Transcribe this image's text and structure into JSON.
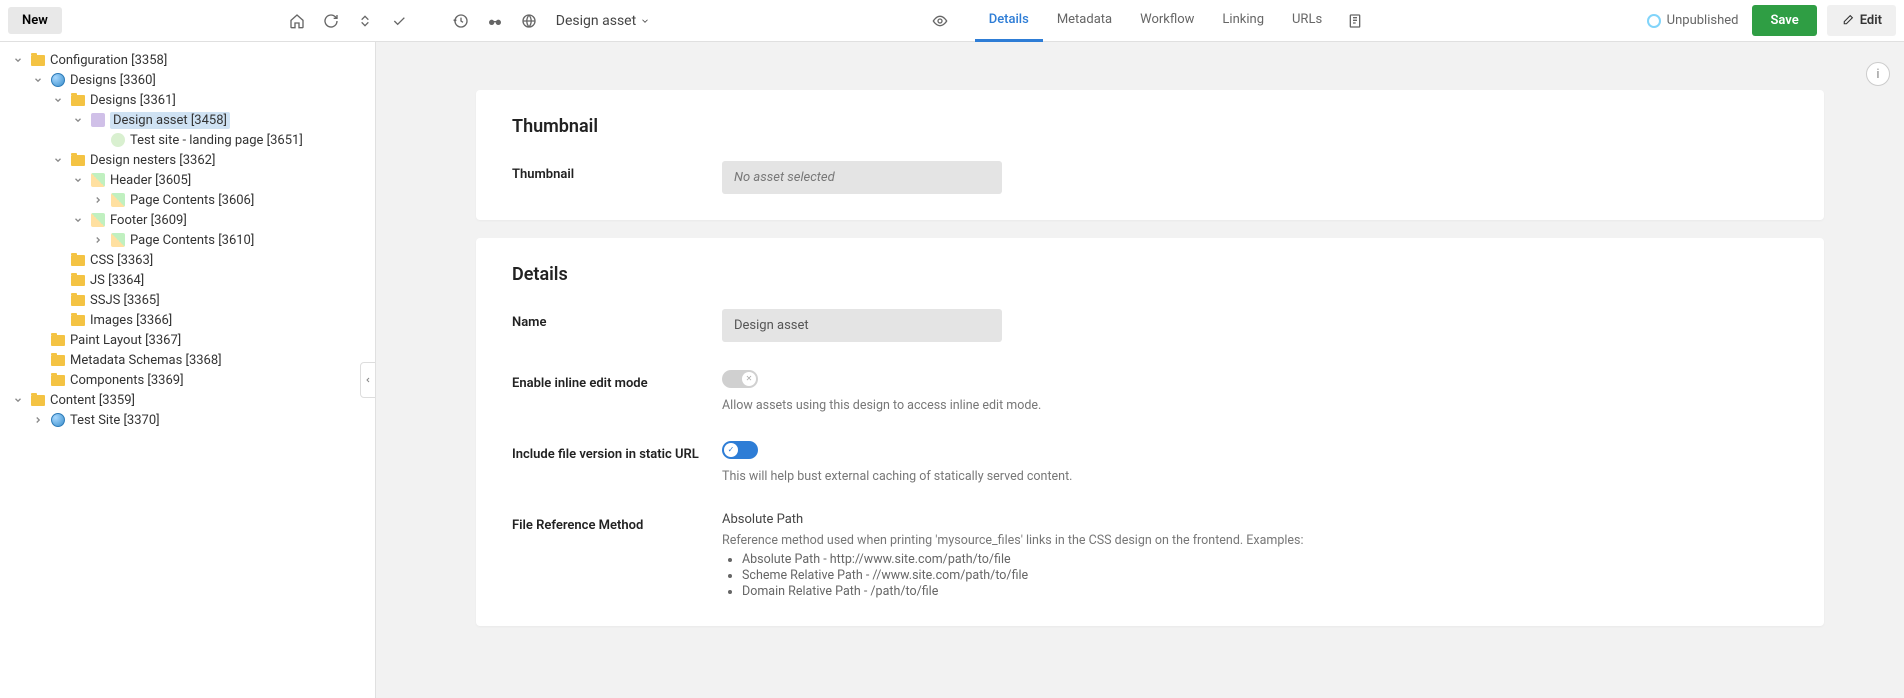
{
  "toolbar": {
    "new_label": "New",
    "breadcrumb": "Design asset",
    "tabs": [
      "Details",
      "Metadata",
      "Workflow",
      "Linking",
      "URLs"
    ],
    "active_tab": 0,
    "status": "Unpublished",
    "save_label": "Save",
    "edit_label": "Edit"
  },
  "tree": [
    {
      "depth": 0,
      "exp": "down",
      "icon": "folder",
      "label": "Configuration [3358]"
    },
    {
      "depth": 1,
      "exp": "down",
      "icon": "site",
      "label": "Designs [3360]"
    },
    {
      "depth": 2,
      "exp": "down",
      "icon": "folder",
      "label": "Designs [3361]"
    },
    {
      "depth": 3,
      "exp": "down",
      "icon": "design",
      "label": "Design asset [3458]",
      "selected": true
    },
    {
      "depth": 4,
      "exp": "none",
      "icon": "apply",
      "label": "Test site - landing page [3651]"
    },
    {
      "depth": 2,
      "exp": "down",
      "icon": "folder",
      "label": "Design nesters [3362]"
    },
    {
      "depth": 3,
      "exp": "down",
      "icon": "nester",
      "label": "Header [3605]"
    },
    {
      "depth": 4,
      "exp": "right",
      "icon": "nester",
      "label": "Page Contents [3606]"
    },
    {
      "depth": 3,
      "exp": "down",
      "icon": "nester",
      "label": "Footer [3609]"
    },
    {
      "depth": 4,
      "exp": "right",
      "icon": "nester",
      "label": "Page Contents [3610]"
    },
    {
      "depth": 2,
      "exp": "none",
      "icon": "folder",
      "label": "CSS [3363]"
    },
    {
      "depth": 2,
      "exp": "none",
      "icon": "folder",
      "label": "JS [3364]"
    },
    {
      "depth": 2,
      "exp": "none",
      "icon": "folder",
      "label": "SSJS [3365]"
    },
    {
      "depth": 2,
      "exp": "none",
      "icon": "folder",
      "label": "Images [3366]"
    },
    {
      "depth": 1,
      "exp": "none",
      "icon": "folder",
      "label": "Paint Layout [3367]"
    },
    {
      "depth": 1,
      "exp": "none",
      "icon": "folder",
      "label": "Metadata Schemas [3368]"
    },
    {
      "depth": 1,
      "exp": "none",
      "icon": "folder",
      "label": "Components [3369]"
    },
    {
      "depth": 0,
      "exp": "down",
      "icon": "folder",
      "label": "Content [3359]"
    },
    {
      "depth": 1,
      "exp": "right",
      "icon": "site",
      "label": "Test Site [3370]"
    }
  ],
  "panels": {
    "thumbnail": {
      "heading": "Thumbnail",
      "field_label": "Thumbnail",
      "value": "No asset selected"
    },
    "details": {
      "heading": "Details",
      "name_label": "Name",
      "name_value": "Design asset",
      "inline_label": "Enable inline edit mode",
      "inline_help": "Allow assets using this design to access inline edit mode.",
      "version_label": "Include file version in static URL",
      "version_help": "This will help bust external caching of statically served content.",
      "ref_label": "File Reference Method",
      "ref_value": "Absolute Path",
      "ref_help": "Reference method used when printing 'mysource_files' links in the CSS design on the frontend. Examples:",
      "ref_examples": [
        "Absolute Path - http://www.site.com/path/to/file",
        "Scheme Relative Path - //www.site.com/path/to/file",
        "Domain Relative Path - /path/to/file"
      ]
    }
  }
}
